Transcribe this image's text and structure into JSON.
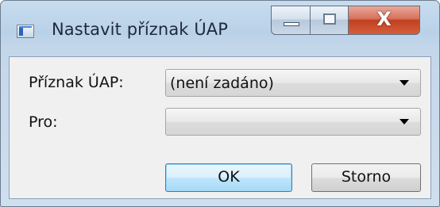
{
  "window": {
    "title": "Nastavit příznak ÚAP",
    "icon": "app-window-icon",
    "close_glyph": "X"
  },
  "form": {
    "flag_label": "Příznak ÚAP:",
    "flag_value": "(není zadáno)",
    "for_label": "Pro:",
    "for_value": ""
  },
  "buttons": {
    "ok_label": "OK",
    "cancel_label": "Storno"
  }
}
